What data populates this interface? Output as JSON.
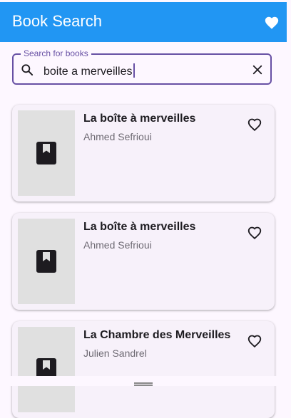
{
  "app": {
    "title": "Book Search",
    "accent": "#2196f3"
  },
  "search": {
    "label": "Search for books",
    "value": "boite a merveilles"
  },
  "results": [
    {
      "title": "La boîte à merveilles",
      "author": "Ahmed Sefrioui"
    },
    {
      "title": "La boîte à merveilles",
      "author": "Ahmed Sefrioui"
    },
    {
      "title": "La Chambre des Merveilles",
      "author": "Julien Sandrel"
    }
  ],
  "icons": {
    "appbar": "heart-filled-icon",
    "search": "search-icon",
    "clear": "close-icon",
    "cover": "book-icon",
    "favorite": "heart-outline-icon"
  }
}
